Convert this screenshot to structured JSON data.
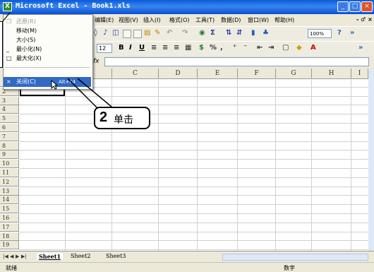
{
  "window": {
    "title": "Microsoft Excel - Book1.xls",
    "app_icon": "excel-icon",
    "controls": {
      "minimize": "_",
      "maximize": "□",
      "close": "×"
    }
  },
  "menubar": {
    "items": [
      "编辑(E)",
      "视图(V)",
      "插入(I)",
      "格式(O)",
      "工具(T)",
      "数据(D)",
      "窗口(W)",
      "帮助(H)"
    ]
  },
  "toolbar": {
    "zoom": "100%",
    "font_size": "12"
  },
  "formula_bar": {
    "fx": "fx",
    "value": ""
  },
  "columns": [
    "C",
    "D",
    "E",
    "F",
    "G",
    "H",
    "I"
  ],
  "rows": [
    "1",
    "2",
    "3",
    "4",
    "5",
    "6",
    "7",
    "8",
    "9",
    "10",
    "11",
    "12",
    "13",
    "14",
    "15",
    "16",
    "17",
    "18",
    "19"
  ],
  "system_menu": {
    "items": [
      {
        "icon": "restore-icon",
        "label": "还原(R)",
        "enabled": false
      },
      {
        "icon": "",
        "label": "移动(M)",
        "enabled": true
      },
      {
        "icon": "",
        "label": "大小(S)",
        "enabled": true
      },
      {
        "icon": "minimize-icon",
        "label": "最小化(N)",
        "enabled": true
      },
      {
        "icon": "maximize-icon",
        "label": "最大化(X)",
        "enabled": true
      }
    ],
    "close_item": {
      "icon": "close-icon",
      "label": "关闭(C)",
      "shortcut": "Alt+F4"
    }
  },
  "sheet_tabs": [
    "Sheet1",
    "Sheet2",
    "Sheet3"
  ],
  "status": {
    "ready": "就绪",
    "num": "数字"
  },
  "callout": {
    "step": "2",
    "text": "单击"
  }
}
